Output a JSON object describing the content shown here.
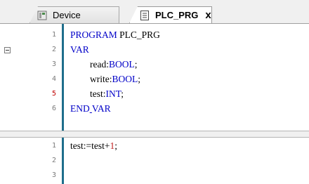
{
  "tabs": [
    {
      "label": "Device"
    },
    {
      "label": "PLC_PRG",
      "close": "x"
    }
  ],
  "declaration": {
    "line_numbers": [
      "1",
      "2",
      "3",
      "4",
      "5",
      "6"
    ],
    "program_kw": "PROGRAM",
    "program_name": " PLC_PRG",
    "var_kw": "VAR",
    "vars": [
      {
        "name": "read",
        "type": "BOOL"
      },
      {
        "name": "write",
        "type": "BOOL"
      },
      {
        "name": "test",
        "type": "INT"
      }
    ],
    "end_var_a": "END",
    "end_var_b": "VAR"
  },
  "implementation": {
    "line_numbers": [
      "1",
      "2",
      "3"
    ],
    "stmt_var": "test",
    "stmt_assign": ":=",
    "stmt_rhs_var": "test",
    "stmt_op": "+",
    "stmt_num": "1",
    "stmt_end": ";"
  },
  "colors": {
    "keyword": "#0000c8",
    "number": "#c02020",
    "gutter": "#1f6e8c",
    "modified_line": "#c00000"
  }
}
